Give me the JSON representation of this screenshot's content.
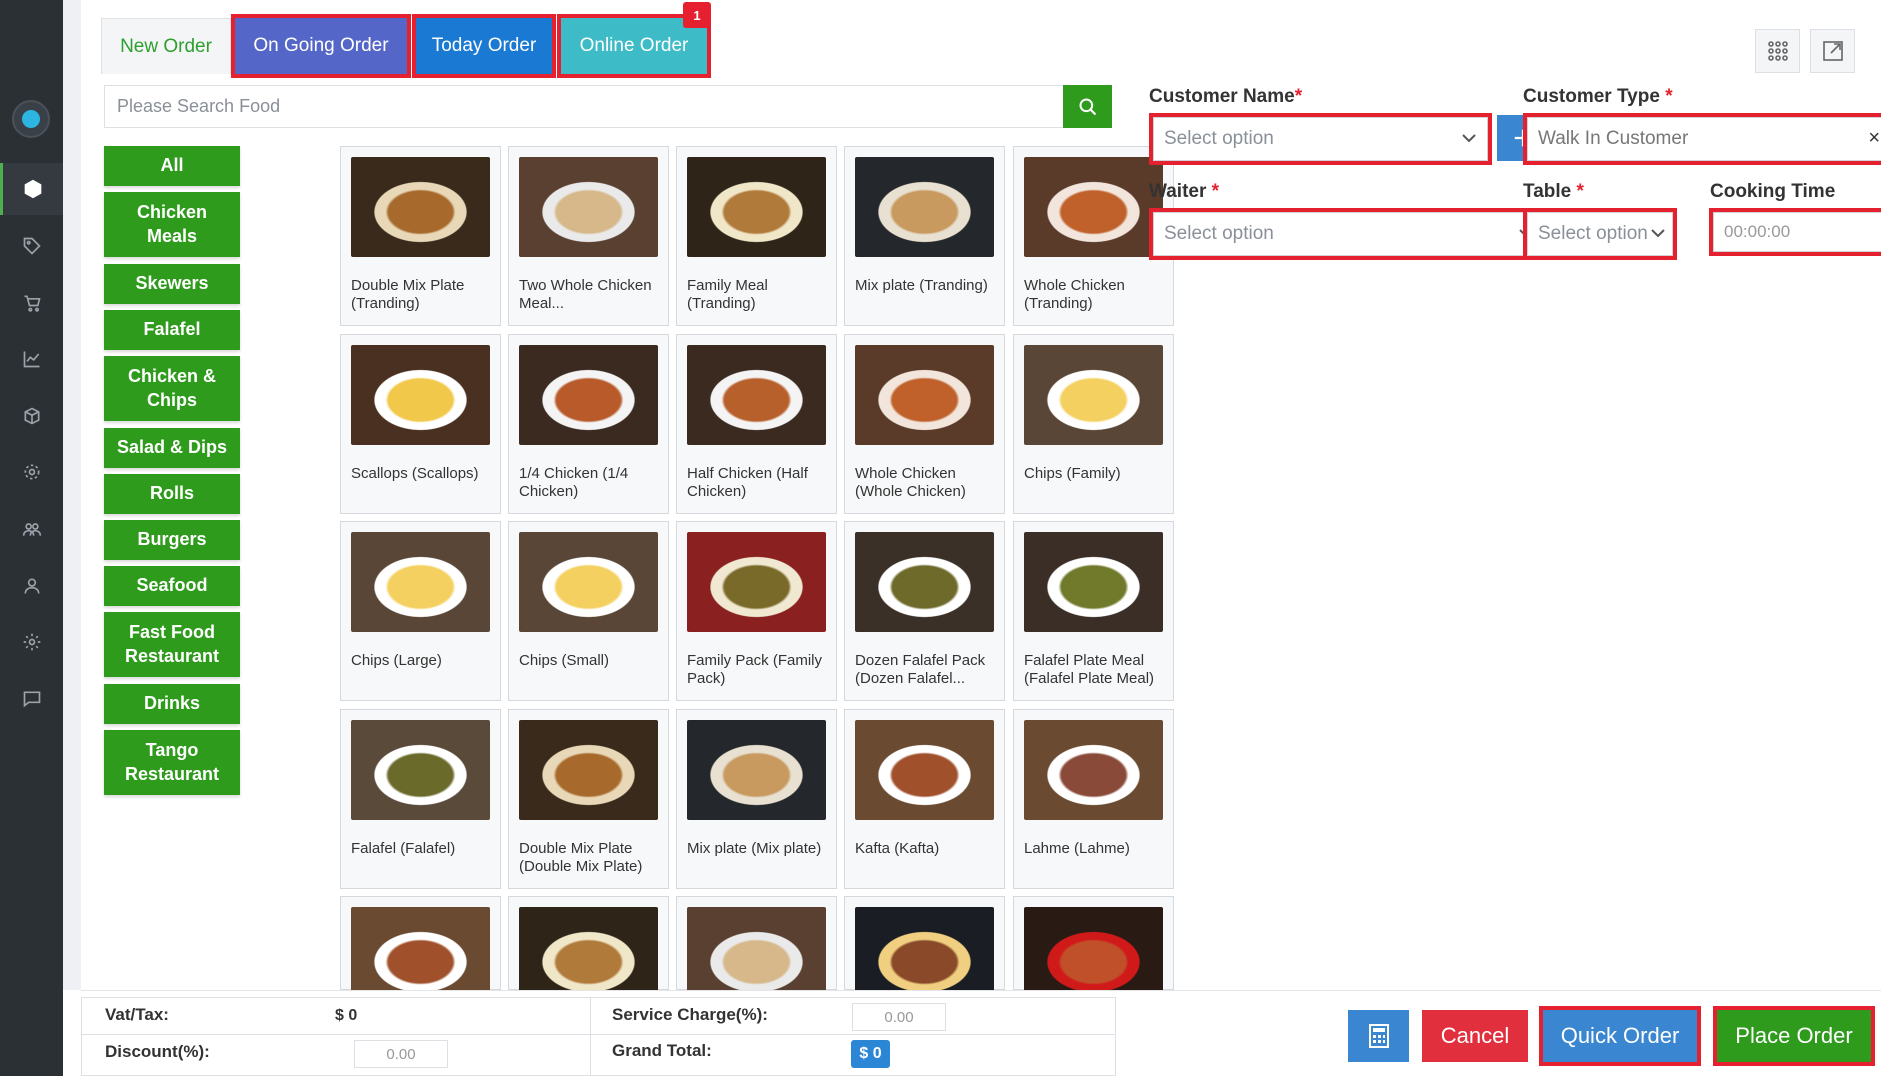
{
  "tabs": {
    "new_order": "New Order",
    "ongoing_order": "On Going Order",
    "today_order": "Today Order",
    "online_order": "Online Order",
    "online_badge": "1"
  },
  "search": {
    "placeholder": "Please Search Food"
  },
  "categories": [
    "All",
    "Chicken Meals",
    "Skewers",
    "Falafel",
    "Chicken & Chips",
    "Salad & Dips",
    "Rolls",
    "Burgers",
    "Seafood",
    "Fast Food Restaurant",
    "Drinks",
    "Tango Restaurant"
  ],
  "foods": [
    {
      "name": "Double Mix Plate (Tranding)",
      "img": "skewer-plate"
    },
    {
      "name": "Two Whole Chicken Meal...",
      "img": "platter"
    },
    {
      "name": "Family Meal (Tranding)",
      "img": "family-platter"
    },
    {
      "name": "Mix plate (Tranding)",
      "img": "mix-plate"
    },
    {
      "name": "Whole Chicken (Tranding)",
      "img": "whole-chicken"
    },
    {
      "name": "Scallops (Scallops)",
      "img": "scallops"
    },
    {
      "name": "1/4 Chicken (1/4 Chicken)",
      "img": "quarter-chicken"
    },
    {
      "name": "Half Chicken (Half Chicken)",
      "img": "half-chicken"
    },
    {
      "name": "Whole Chicken (Whole Chicken)",
      "img": "whole-chicken"
    },
    {
      "name": "Chips (Family)",
      "img": "chips"
    },
    {
      "name": "Chips (Large)",
      "img": "chips"
    },
    {
      "name": "Chips (Small)",
      "img": "chips"
    },
    {
      "name": "Family Pack (Family Pack)",
      "img": "falafel-pack"
    },
    {
      "name": "Dozen Falafel Pack (Dozen Falafel...",
      "img": "falafel-dozen"
    },
    {
      "name": "Falafel Plate Meal (Falafel Plate Meal)",
      "img": "falafel-plate"
    },
    {
      "name": "Falafel (Falafel)",
      "img": "falafel"
    },
    {
      "name": "Double Mix Plate (Double Mix Plate)",
      "img": "skewer-plate"
    },
    {
      "name": "Mix plate (Mix plate)",
      "img": "mix-plate"
    },
    {
      "name": "Kafta (Kafta)",
      "img": "kafta"
    },
    {
      "name": "Lahme (Lahme)",
      "img": "lahme"
    },
    {
      "name": "",
      "img": "kafta"
    },
    {
      "name": "",
      "img": "family-platter"
    },
    {
      "name": "",
      "img": "platter"
    },
    {
      "name": "",
      "img": "chicken-dark"
    },
    {
      "name": "",
      "img": "chicken-cola"
    }
  ],
  "form": {
    "customer_name_label": "Customer Name",
    "customer_name_placeholder": "Select option",
    "customer_type_label": "Customer Type",
    "customer_type_value": "Walk In Customer",
    "waiter_label": "Waiter",
    "waiter_placeholder": "Select option",
    "table_label": "Table",
    "table_placeholder": "Select option",
    "cooking_time_label": "Cooking Time",
    "cooking_time_value": "00:00:00",
    "required_mark": "*",
    "clear_mark": "×"
  },
  "summary": {
    "vat_label": "Vat/Tax:",
    "vat_value": "$ 0",
    "discount_label": "Discount(%):",
    "discount_value": "0.00",
    "service_label": "Service Charge(%):",
    "service_value": "0.00",
    "total_label": "Grand Total:",
    "total_value": "$ 0"
  },
  "buttons": {
    "cancel": "Cancel",
    "quick_order": "Quick Order",
    "place_order": "Place Order"
  },
  "colors": {
    "primary_green": "#2e9b1c",
    "blue": "#3a86d0",
    "red_highlight": "#e5202f",
    "sidebar": "#2b3035"
  }
}
